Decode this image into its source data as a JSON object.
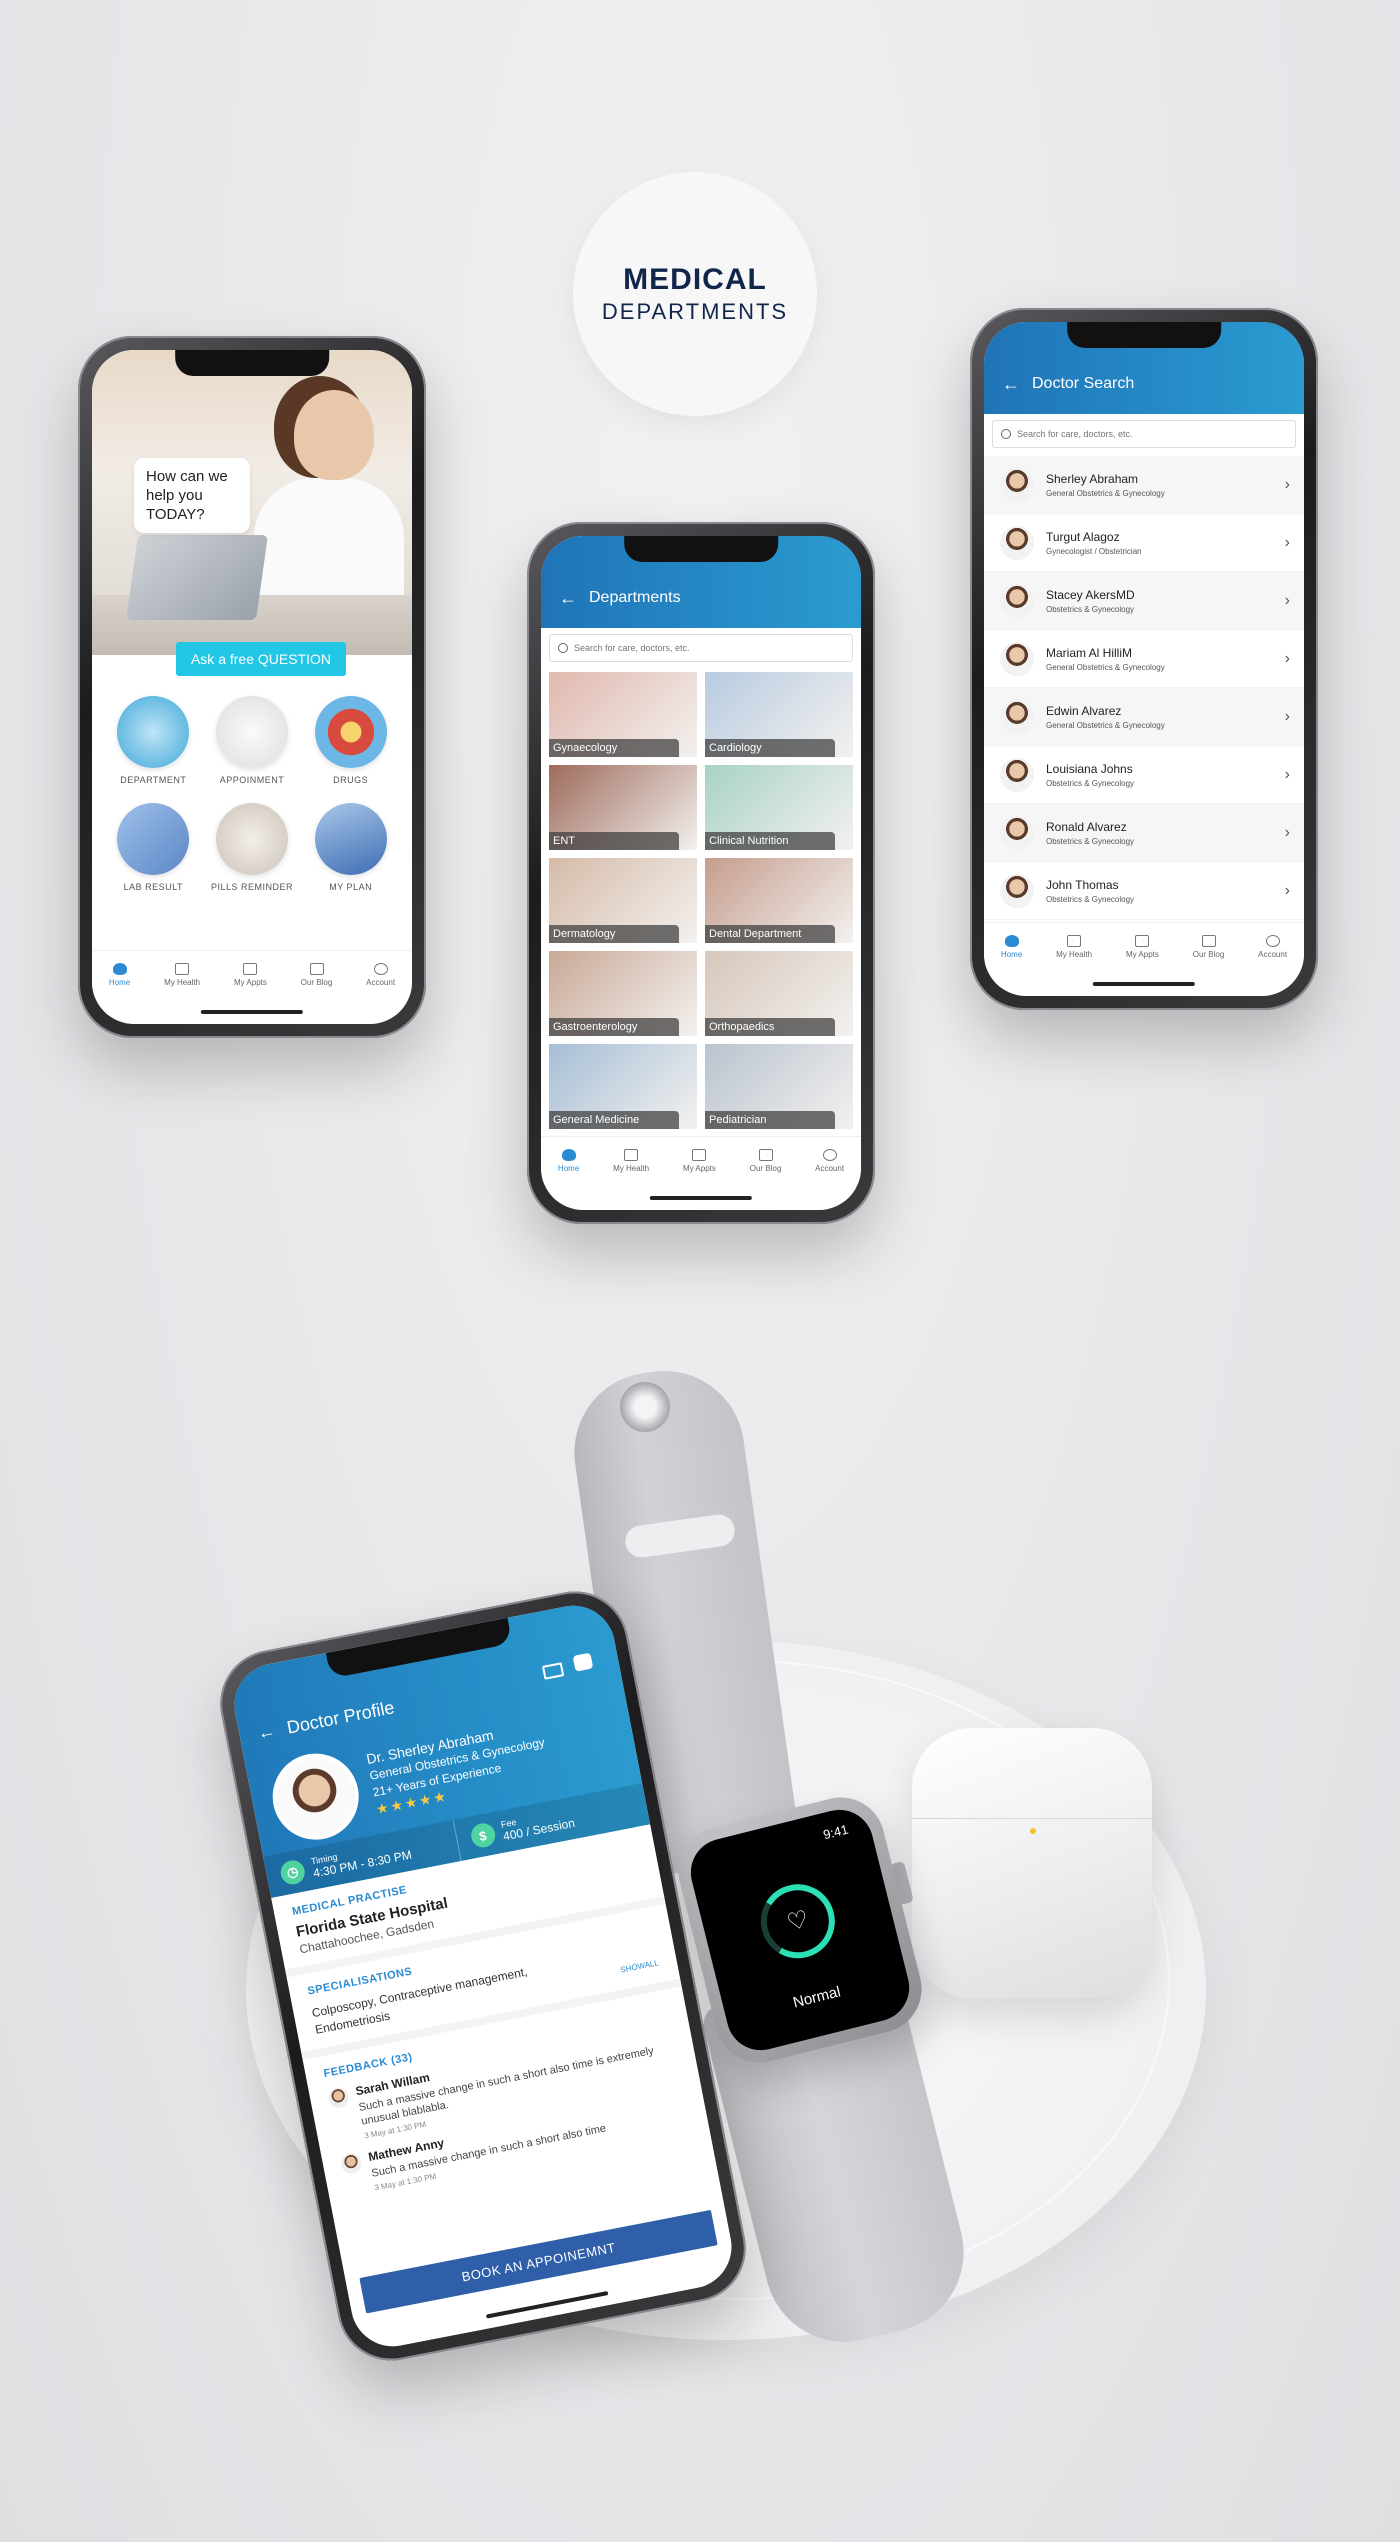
{
  "badge": {
    "line1": "MEDICAL",
    "line2": "DEPARTMENTS"
  },
  "tabbar": [
    "Home",
    "My Health",
    "My Appts",
    "Our Blog",
    "Account"
  ],
  "home": {
    "bubble": "How can we help you TODAY?",
    "ask_button": "Ask a free QUESTION",
    "features": [
      {
        "label": "DEPARTMENT",
        "color": "#3ea8d8"
      },
      {
        "label": "APPOINMENT",
        "color": "#e7e7e7"
      },
      {
        "label": "DRUGS",
        "color": "#d84a3e"
      },
      {
        "label": "LAB RESULT",
        "color": "#5b86c6"
      },
      {
        "label": "PILLS REMINDER",
        "color": "#c9c2b9"
      },
      {
        "label": "MY PLAN",
        "color": "#3d6db3"
      }
    ]
  },
  "departments": {
    "title": "Departments",
    "search_placeholder": "Search for care, doctors, etc.",
    "items": [
      {
        "name": "Gynaecology",
        "color": "#e0b8ae"
      },
      {
        "name": "Cardiology",
        "color": "#b8cbe0"
      },
      {
        "name": "ENT",
        "color": "#9e6b5b"
      },
      {
        "name": "Clinical Nutrition",
        "color": "#a8d2c6"
      },
      {
        "name": "Dermatology",
        "color": "#d5bba8"
      },
      {
        "name": "Dental Department",
        "color": "#c59d8d"
      },
      {
        "name": "Gastroenterology",
        "color": "#c8a896"
      },
      {
        "name": "Orthopaedics",
        "color": "#d6c7bb"
      },
      {
        "name": "General Medicine",
        "color": "#a6bed6"
      },
      {
        "name": "Pediatrician",
        "color": "#b9c3cf"
      }
    ]
  },
  "doctor_search": {
    "title": "Doctor Search",
    "search_placeholder": "Search for care, doctors, etc.",
    "doctors": [
      {
        "name": "Sherley Abraham",
        "specialty": "General Obstetrics & Gynecology"
      },
      {
        "name": "Turgut Alagoz",
        "specialty": "Gynecologist / Obstetrician"
      },
      {
        "name": "Stacey AkersMD",
        "specialty": "Obstetrics & Gynecology"
      },
      {
        "name": "Mariam Al HilliM",
        "specialty": "General Obstetrics & Gynecology"
      },
      {
        "name": "Edwin Alvarez",
        "specialty": "General Obstetrics & Gynecology"
      },
      {
        "name": "Louisiana Johns",
        "specialty": "Obstetrics & Gynecology"
      },
      {
        "name": "Ronald Alvarez",
        "specialty": "Obstetrics & Gynecology"
      },
      {
        "name": "John Thomas",
        "specialty": "Obstetrics & Gynecology"
      }
    ]
  },
  "profile": {
    "title": "Doctor Profile",
    "name": "Dr. Sherley Abraham",
    "specialty": "General Obstetrics & Gynecology",
    "experience": "21+ Years of Experience",
    "stars": "★★★★★",
    "timing_label": "Timing",
    "timing_value": "4:30 PM - 8:30 PM",
    "fee_label": "Fee",
    "fee_value": "400 / Session",
    "practise_heading": "MEDICAL PRACTISE",
    "hospital": "Florida State Hospital",
    "location": "Chattahoochee, Gadsden",
    "spec_heading": "SPECIALISATIONS",
    "specialisations": "Colposcopy, Contraceptive management, Endometriosis",
    "show_all": "SHOWALL",
    "feedback_heading": "FEEDBACK (33)",
    "feedback": [
      {
        "name": "Sarah Willam",
        "text": "Such a massive change in such a short also time is extremely unusual blablabla.",
        "date": "3 May at 1:30 PM"
      },
      {
        "name": "Mathew Anny",
        "text": "Such a massive change in such a short also time",
        "date": "3 May at 1:30 PM"
      }
    ],
    "book_button": "BOOK AN APPOINEMNT"
  },
  "watch": {
    "time": "9:41",
    "status": "Normal"
  }
}
